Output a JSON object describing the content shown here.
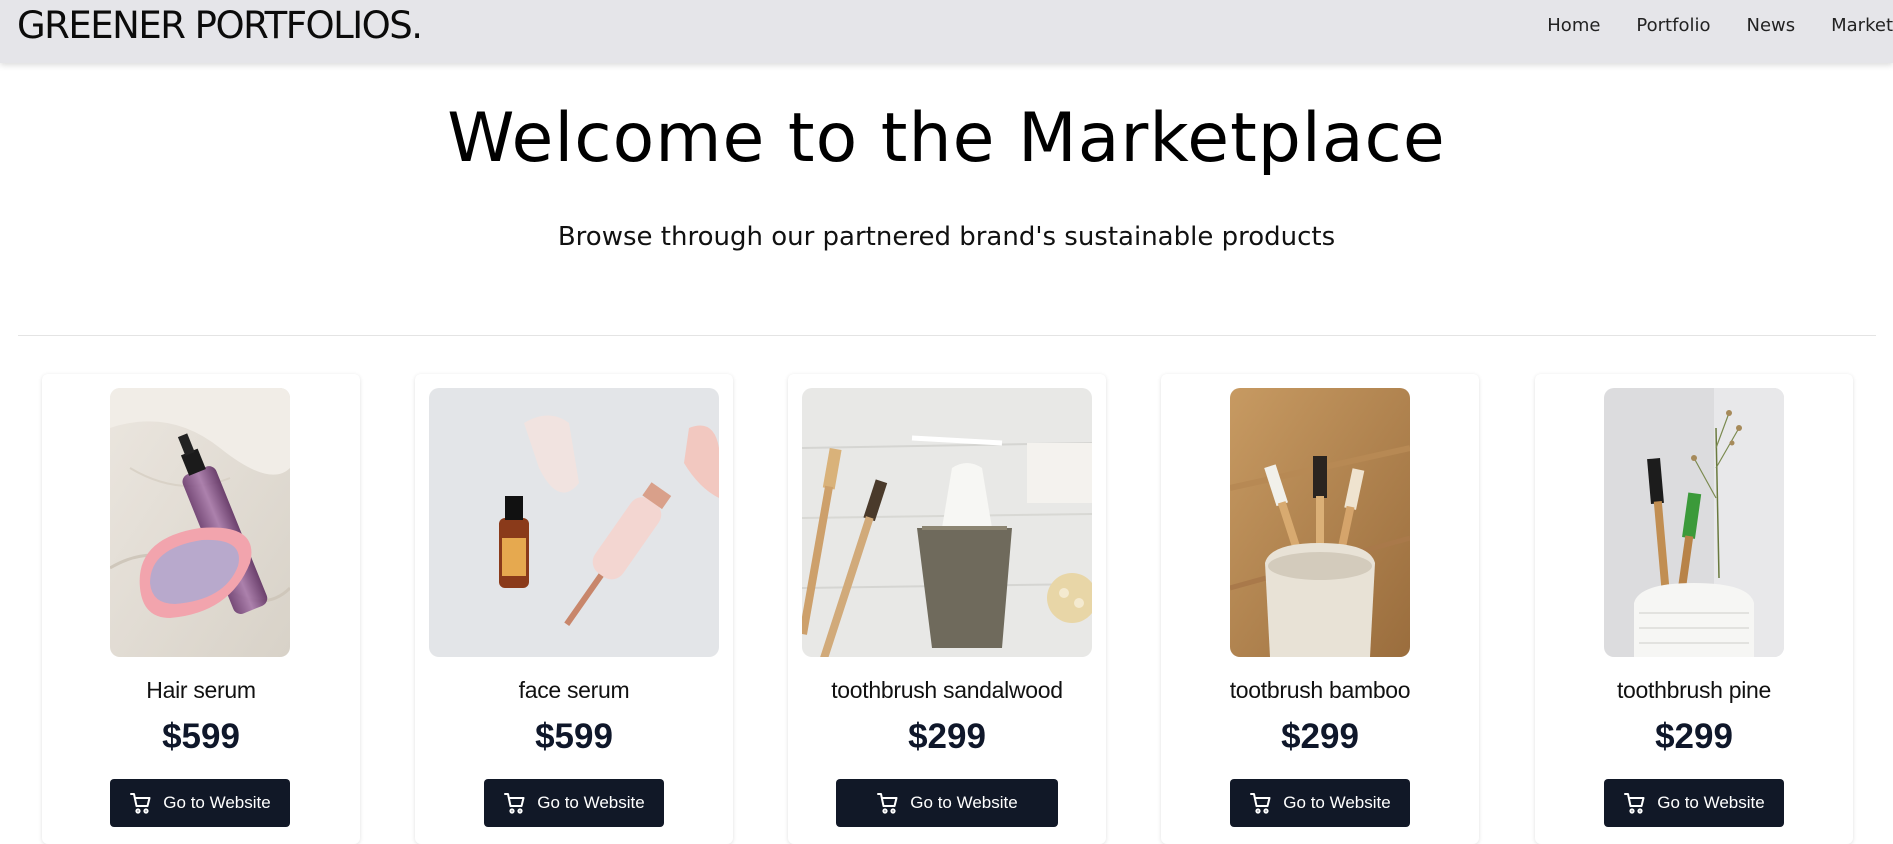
{
  "header": {
    "logo": "GREENER PORTFOLIOS.",
    "nav": [
      "Home",
      "Portfolio",
      "News",
      "Market"
    ]
  },
  "hero": {
    "title": "Welcome to the Marketplace",
    "subtitle": "Browse through our partnered brand's sustainable products"
  },
  "products": [
    {
      "name": "Hair serum",
      "price": "$599",
      "button": "Go to Website",
      "icon": "cart-icon"
    },
    {
      "name": "face serum",
      "price": "$599",
      "button": "Go to Website",
      "icon": "cart-icon"
    },
    {
      "name": "toothbrush sandalwood",
      "price": "$299",
      "button": "Go to Website",
      "icon": "cart-icon"
    },
    {
      "name": "tootbrush bamboo",
      "price": "$299",
      "button": "Go to Website",
      "icon": "cart-icon"
    },
    {
      "name": "toothbrush pine",
      "price": "$299",
      "button": "Go to Website",
      "icon": "cart-icon"
    }
  ],
  "colors": {
    "navbar_bg": "#e5e5e9",
    "button_bg": "#111827",
    "price_text": "#0f172a"
  }
}
